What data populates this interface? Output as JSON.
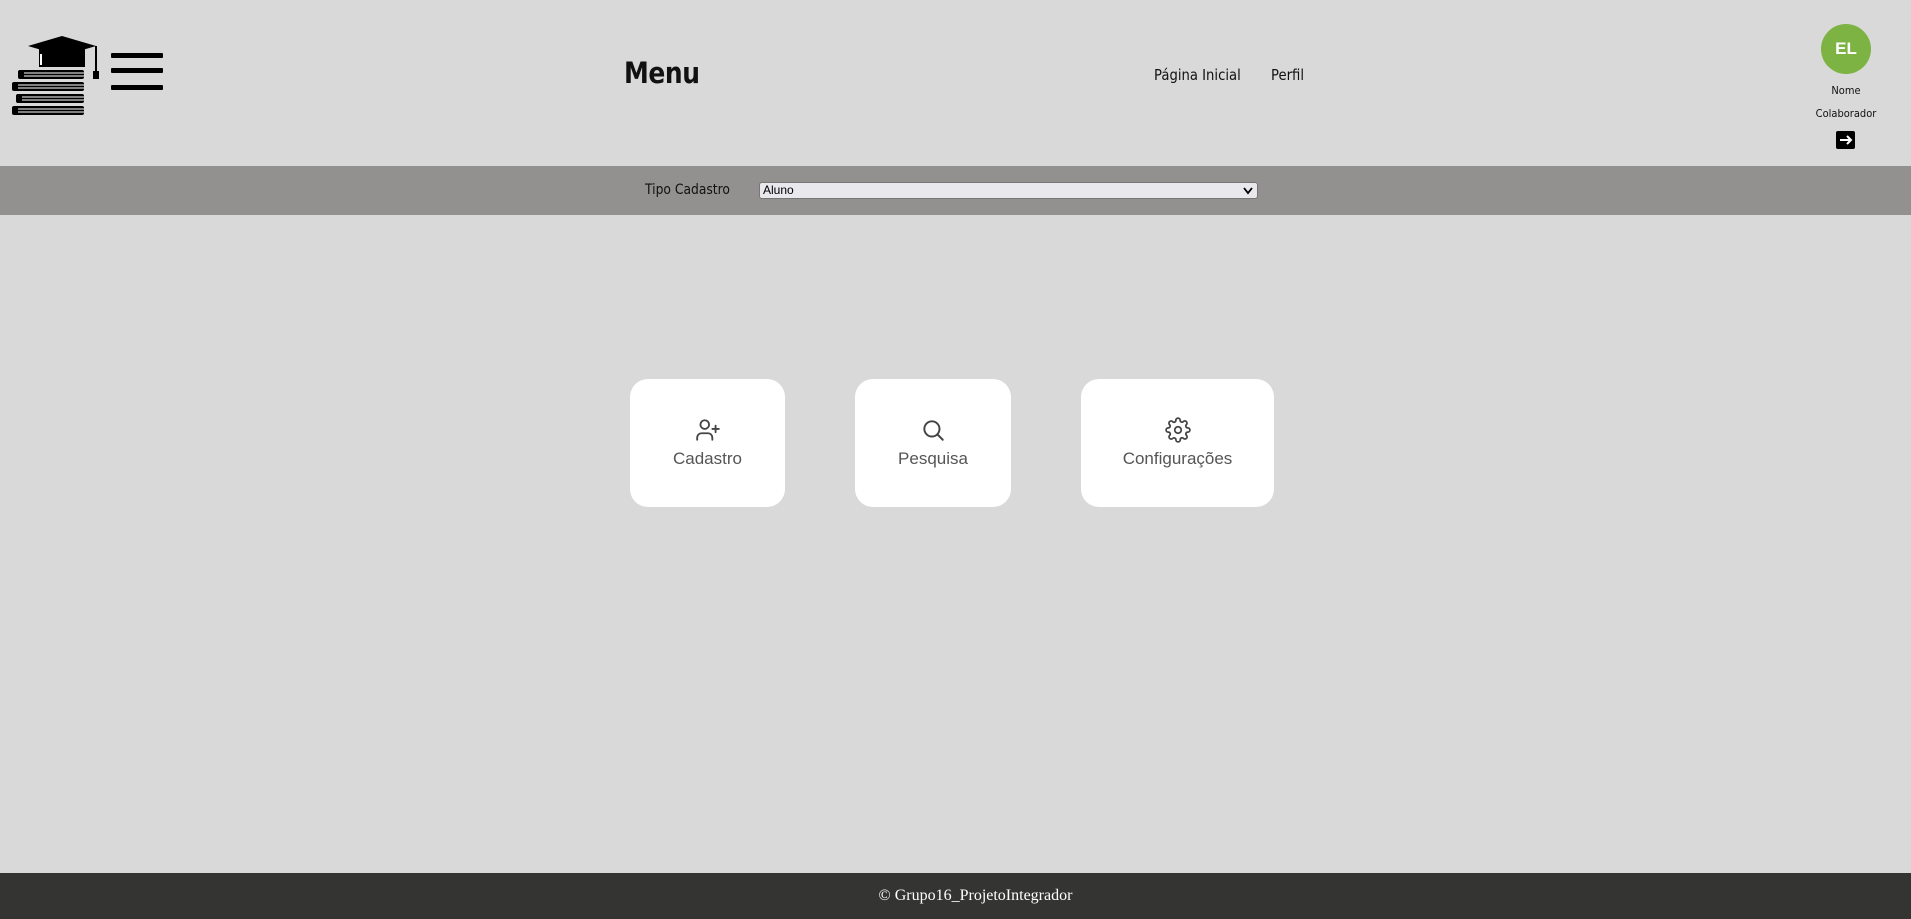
{
  "header": {
    "title": "Menu",
    "nav": [
      {
        "label": "Página Inicial"
      },
      {
        "label": "Perfil"
      }
    ],
    "user": {
      "initials": "EL",
      "name": "Nome",
      "role": "Colaborador",
      "avatar_color": "#7cb342"
    }
  },
  "filter": {
    "label": "Tipo Cadastro",
    "selected": "Aluno"
  },
  "cards": [
    {
      "label": "Cadastro",
      "icon": "user-plus-icon"
    },
    {
      "label": "Pesquisa",
      "icon": "search-icon"
    },
    {
      "label": "Configurações",
      "icon": "gear-icon"
    }
  ],
  "footer": {
    "text": "© Grupo16_ProjetoIntegrador"
  },
  "colors": {
    "background": "#d9d9d9",
    "filter_bar": "#929190",
    "footer": "#343432",
    "card": "#ffffff"
  }
}
